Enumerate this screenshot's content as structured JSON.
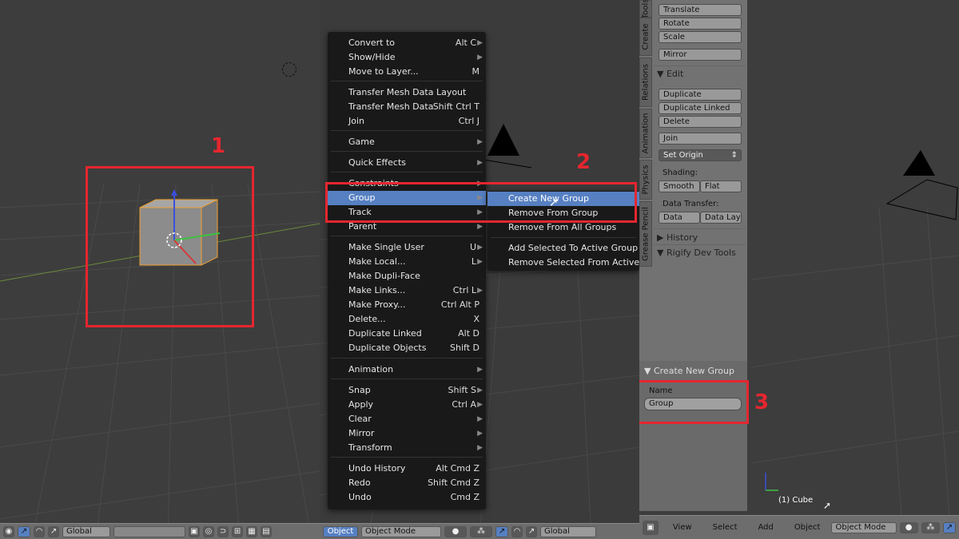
{
  "panel1": {
    "annotation": "1",
    "header": {
      "orientation": "Global"
    }
  },
  "menu": {
    "items": [
      {
        "label": "Convert to",
        "shortcut": "Alt C",
        "submenu": true
      },
      {
        "label": "Show/Hide",
        "shortcut": "",
        "submenu": true
      },
      {
        "label": "Move to Layer...",
        "shortcut": "M",
        "submenu": false
      },
      {
        "label": "Transfer Mesh Data Layout",
        "shortcut": "",
        "submenu": false
      },
      {
        "label": "Transfer Mesh Data",
        "shortcut": "Shift Ctrl T",
        "submenu": false
      },
      {
        "label": "Join",
        "shortcut": "Ctrl J",
        "submenu": false
      },
      {
        "label": "Game",
        "shortcut": "",
        "submenu": true
      },
      {
        "label": "Quick Effects",
        "shortcut": "",
        "submenu": true
      },
      {
        "label": "Constraints",
        "shortcut": "",
        "submenu": true
      },
      {
        "label": "Group",
        "shortcut": "",
        "submenu": true
      },
      {
        "label": "Track",
        "shortcut": "",
        "submenu": true
      },
      {
        "label": "Parent",
        "shortcut": "",
        "submenu": true
      },
      {
        "label": "Make Single User",
        "shortcut": "U",
        "submenu": true
      },
      {
        "label": "Make Local...",
        "shortcut": "L",
        "submenu": true
      },
      {
        "label": "Make Dupli-Face",
        "shortcut": "",
        "submenu": false
      },
      {
        "label": "Make Links...",
        "shortcut": "Ctrl L",
        "submenu": true
      },
      {
        "label": "Make Proxy...",
        "shortcut": "Ctrl Alt P",
        "submenu": false
      },
      {
        "label": "Delete...",
        "shortcut": "X",
        "submenu": false
      },
      {
        "label": "Duplicate Linked",
        "shortcut": "Alt D",
        "submenu": false
      },
      {
        "label": "Duplicate Objects",
        "shortcut": "Shift D",
        "submenu": false
      },
      {
        "label": "Animation",
        "shortcut": "",
        "submenu": true
      },
      {
        "label": "Snap",
        "shortcut": "Shift S",
        "submenu": true
      },
      {
        "label": "Apply",
        "shortcut": "Ctrl A",
        "submenu": true
      },
      {
        "label": "Clear",
        "shortcut": "",
        "submenu": true
      },
      {
        "label": "Mirror",
        "shortcut": "",
        "submenu": true
      },
      {
        "label": "Transform",
        "shortcut": "",
        "submenu": true
      },
      {
        "label": "Undo History",
        "shortcut": "Alt Cmd Z",
        "submenu": false
      },
      {
        "label": "Redo",
        "shortcut": "Shift Cmd Z",
        "submenu": false
      },
      {
        "label": "Undo",
        "shortcut": "Cmd Z",
        "submenu": false
      }
    ],
    "submenu": [
      "Create New Group",
      "Remove From Group",
      "Remove From All Groups",
      "Add Selected To Active Group",
      "Remove Selected From Active Grou"
    ],
    "annotation": "2",
    "header": {
      "menu_label": "Object",
      "mode": "Object Mode",
      "orientation": "Global"
    }
  },
  "toolshelf": {
    "tabs": [
      "Tools",
      "Create",
      "Relations",
      "Animation",
      "Physics",
      "Grease Pencil"
    ],
    "transform_buttons": [
      "Translate",
      "Rotate",
      "Scale"
    ],
    "mirror": "Mirror",
    "edit_title": "Edit",
    "edit_buttons": [
      "Duplicate",
      "Duplicate Linked",
      "Delete"
    ],
    "join": "Join",
    "set_origin": "Set Origin",
    "shading_label": "Shading:",
    "smooth": "Smooth",
    "flat": "Flat",
    "data_transfer_label": "Data Transfer:",
    "data": "Data",
    "data_lay": "Data Lay",
    "history": "History",
    "rigify": "Rigify Dev Tools",
    "operator_title": "Create New Group",
    "name_label": "Name",
    "name_value": "Group",
    "annotation": "3"
  },
  "panel3": {
    "object_label": "(1) Cube",
    "header": {
      "view": "View",
      "select": "Select",
      "add": "Add",
      "object": "Object",
      "mode": "Object Mode"
    }
  },
  "colors": {
    "annotation_red": "#e5262f",
    "menu_highlight": "#5680c2",
    "selection_orange": "#f0a030"
  }
}
